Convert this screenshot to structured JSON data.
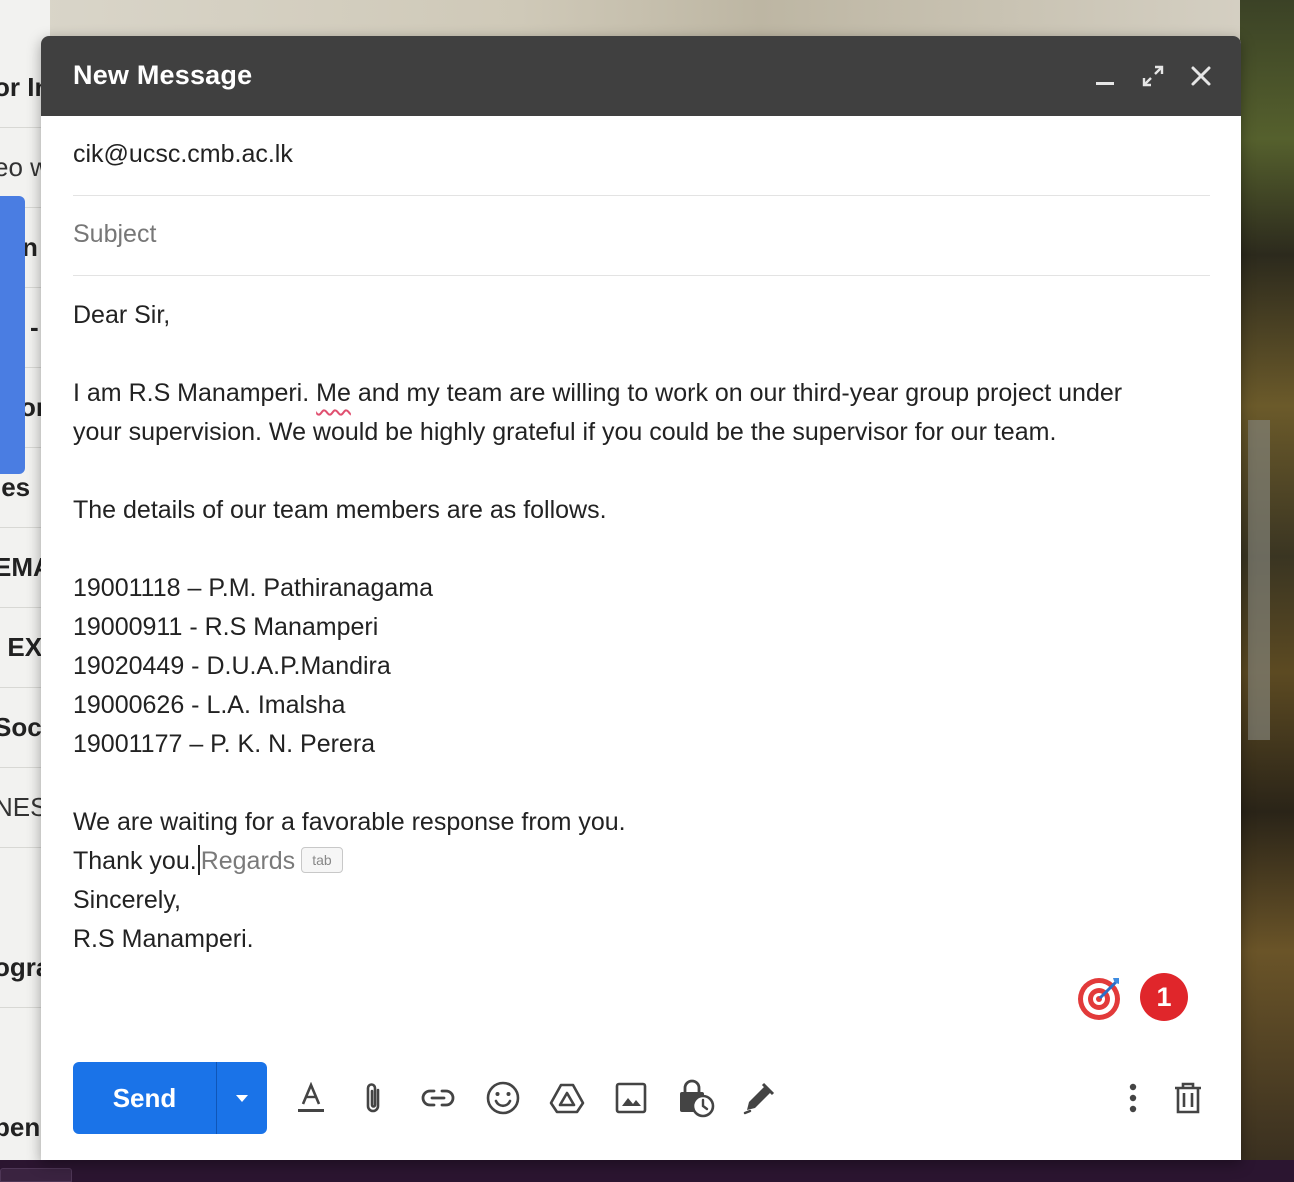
{
  "background": {
    "inbox_fragments": [
      "or In",
      "eo w",
      "n",
      "-",
      "or",
      "ies",
      "EMA",
      "' EX",
      "Soc",
      "NES",
      "ogra",
      "pen"
    ]
  },
  "compose": {
    "title": "New Message",
    "to": "cik@ucsc.cmb.ac.lk",
    "subject_placeholder": "Subject",
    "subject_value": "",
    "body": {
      "greeting": "Dear Sir,",
      "intro_before_flag": "I am R.S Manamperi. ",
      "flagged_word": "Me",
      "intro_after_flag": " and my team are willing to work on our third-year group project under",
      "intro_line2": "your supervision. We would be highly grateful if you could be the supervisor for our team.",
      "details_line": "The details of our team members are as follows.",
      "members": [
        "19001118 – P.M. Pathiranagama",
        "19000911 - R.S Manamperi",
        "19020449 - D.U.A.P.Mandira",
        "19000626 - L.A. Imalsha",
        "19001177 – P. K. N. Perera"
      ],
      "waiting_line": "We are waiting for a favorable response from you.",
      "thanks_line": "Thank you.",
      "smart_compose_suggestion": "Regards",
      "smart_compose_hint": "tab",
      "closing": "Sincerely,",
      "signature": "R.S Manamperi."
    },
    "notification_count": "1",
    "send_label": "Send"
  },
  "icons": {
    "header": [
      "minimize-icon",
      "expand-icon",
      "close-icon"
    ],
    "toolbar": [
      "formatting-icon",
      "attach-icon",
      "link-icon",
      "emoji-icon",
      "drive-icon",
      "photo-icon",
      "confidential-icon",
      "signature-icon",
      "more-options-icon",
      "discard-icon"
    ]
  },
  "colors": {
    "header_bg": "#404040",
    "send_blue": "#1a73e8",
    "badge_red": "#e0262b",
    "spellcheck_underline": "#e05070"
  }
}
